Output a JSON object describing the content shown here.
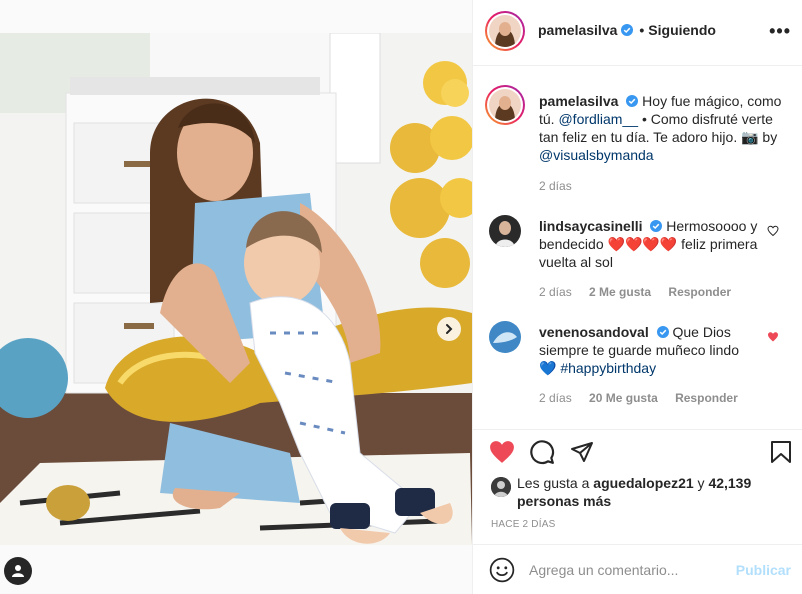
{
  "header": {
    "username": "pamelasilva",
    "separator": "•",
    "follow_state": "Siguiendo"
  },
  "caption": {
    "username": "pamelasilva",
    "text_1": "Hoy fue mágico, como tú.",
    "mention_1": "@fordliam__",
    "text_2": "• Como disfruté verte tan feliz en tu día. Te adoro hijo. 📷 by",
    "mention_2": "@visualsbymanda",
    "time": "2 días"
  },
  "comments": [
    {
      "username": "lindsaycasinelli",
      "text_1": "Hermosoooo y bendecido",
      "emojis": "❤️❤️❤️❤️",
      "text_2": "feliz primera vuelta al sol",
      "time": "2 días",
      "likes": "2 Me gusta",
      "reply": "Responder",
      "liked": false
    },
    {
      "username": "venenosandoval",
      "text_1": "Que Dios siempre te guarde muñeco lindo",
      "emojis": "💙",
      "hashtag": "#happybirthday",
      "time": "2 días",
      "likes": "20 Me gusta",
      "reply": "Responder",
      "liked": true
    }
  ],
  "likes": {
    "prefix": "Les gusta a",
    "user": "aguedalopez21",
    "connector": "y",
    "count": "42,139 personas más"
  },
  "timestamp": "Hace 2 días",
  "add_comment": {
    "placeholder": "Agrega un comentario...",
    "publish_label": "Publicar"
  },
  "icons": {
    "like": "heart-filled-icon",
    "comment": "speech-bubble-icon",
    "share": "paper-plane-icon",
    "save": "bookmark-icon",
    "emoji": "smiley-icon",
    "more": "ellipsis-icon",
    "next": "chevron-right-icon",
    "tags": "person-tag-icon"
  },
  "colors": {
    "heart": "#ed4956",
    "verified": "#3897f0",
    "link": "#00376b",
    "muted": "#8e8e8e",
    "publish_disabled": "#b2dffc"
  }
}
